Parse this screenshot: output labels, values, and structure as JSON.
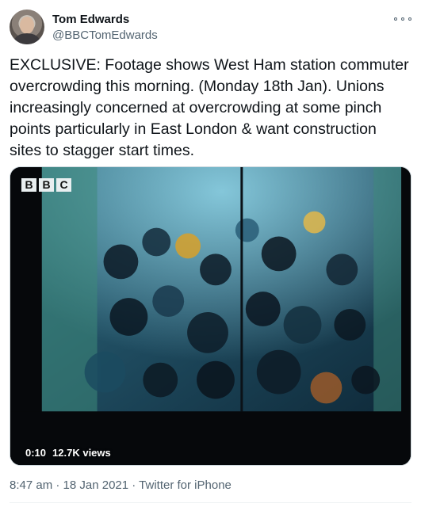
{
  "author": {
    "name": "Tom Edwards",
    "handle": "@BBCTomEdwards"
  },
  "tweet": {
    "text": "EXCLUSIVE: Footage shows West Ham station commuter overcrowding this morning. (Monday 18th Jan). Unions increasingly concerned at overcrowding at some pinch points particularly in East London & want construction sites to stagger start times."
  },
  "video": {
    "logo_letters": [
      "B",
      "B",
      "C"
    ],
    "duration": "0:10",
    "views": "12.7K views"
  },
  "meta": {
    "timestamp": "8:47 am · 18 Jan 2021 · Twitter for iPhone"
  },
  "icons": {
    "more": "more-options-icon"
  }
}
